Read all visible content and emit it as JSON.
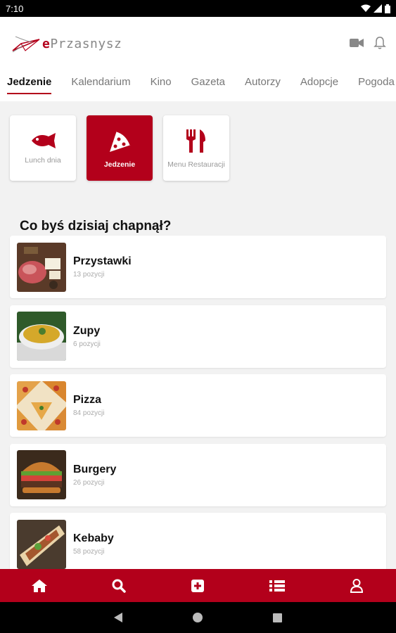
{
  "status_bar": {
    "time": "7:10"
  },
  "header": {
    "logo_prefix": "e",
    "logo_name": "Przasnysz"
  },
  "tabs": [
    {
      "label": "Jedzenie",
      "active": true
    },
    {
      "label": "Kalendarium"
    },
    {
      "label": "Kino"
    },
    {
      "label": "Gazeta"
    },
    {
      "label": "Autorzy"
    },
    {
      "label": "Adopcje"
    },
    {
      "label": "Pogoda"
    }
  ],
  "categories": [
    {
      "label": "Lunch dnia",
      "icon": "fish-icon"
    },
    {
      "label": "Jedzenie",
      "icon": "pizza-slice-icon",
      "active": true
    },
    {
      "label": "Menu Restauracji",
      "icon": "cutlery-icon"
    }
  ],
  "section_title": "Co byś dzisiaj chapnął?",
  "items": [
    {
      "name": "Przystawki",
      "count": "13 pozycji"
    },
    {
      "name": "Zupy",
      "count": "6 pozycji"
    },
    {
      "name": "Pizza",
      "count": "84 pozycji"
    },
    {
      "name": "Burgery",
      "count": "26 pozycji"
    },
    {
      "name": "Kebaby",
      "count": "58 pozycji"
    }
  ],
  "colors": {
    "brand": "#b3001b"
  },
  "bottom_nav": [
    "home-icon",
    "search-icon",
    "add-icon",
    "list-icon",
    "user-icon"
  ]
}
